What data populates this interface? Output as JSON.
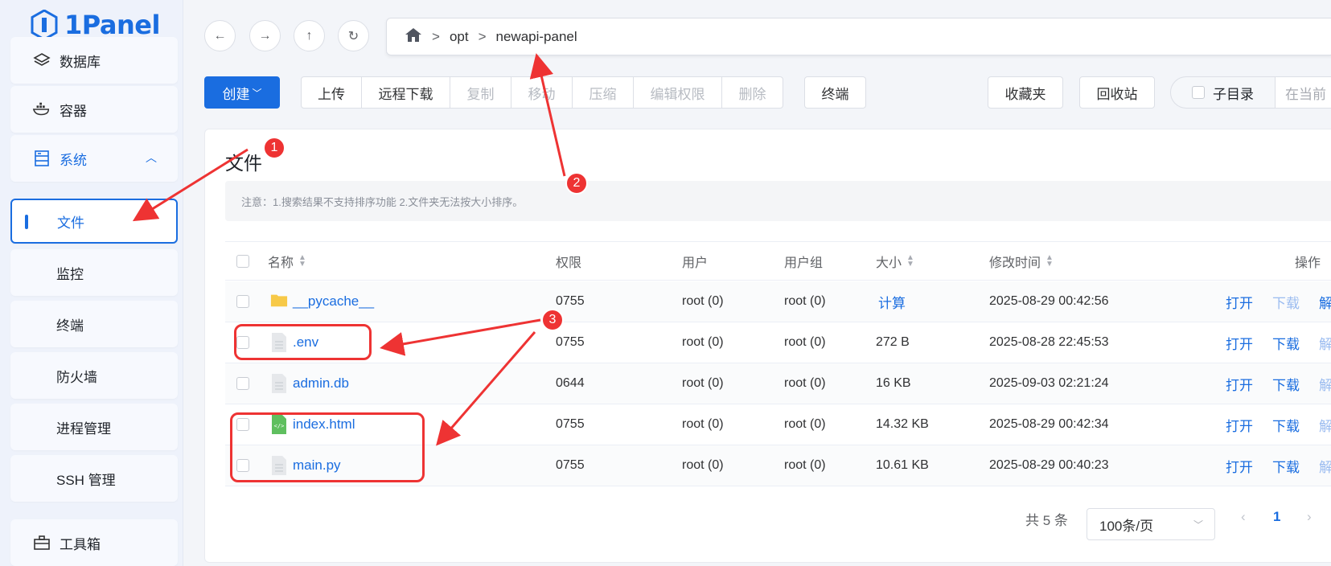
{
  "app": {
    "name": "1Panel"
  },
  "sidebar": {
    "items": [
      {
        "label": "数据库",
        "icon": "layers-icon"
      },
      {
        "label": "容器",
        "icon": "docker-icon"
      },
      {
        "label": "系统",
        "icon": "server-icon"
      },
      {
        "label": "文件"
      },
      {
        "label": "监控"
      },
      {
        "label": "终端"
      },
      {
        "label": "防火墙"
      },
      {
        "label": "进程管理"
      },
      {
        "label": "SSH 管理"
      },
      {
        "label": "工具箱",
        "icon": "toolbox-icon"
      }
    ]
  },
  "breadcrumb": {
    "segments": [
      "opt",
      "newapi-panel"
    ],
    "separator": ">"
  },
  "toolbar": {
    "create": "创建",
    "upload": "上传",
    "remote_download": "远程下载",
    "copy": "复制",
    "move": "移动",
    "compress": "压缩",
    "edit_permission": "编辑权限",
    "delete": "删除",
    "terminal": "终端",
    "favorites": "收藏夹",
    "recycle": "回收站",
    "subdir": "子目录",
    "search_placeholder": "在当前"
  },
  "card": {
    "title": "文件",
    "notice": "注意：1.搜索结果不支持排序功能 2.文件夹无法按大小排序。"
  },
  "table": {
    "headers": {
      "name": "名称",
      "perm": "权限",
      "user": "用户",
      "group": "用户组",
      "size": "大小",
      "mtime": "修改时间",
      "ops": "操作"
    },
    "rows": [
      {
        "name": "__pycache__",
        "type": "folder",
        "perm": "0755",
        "user": "root (0)",
        "group": "root (0)",
        "size": "计算",
        "mtime": "2025-08-29 00:42:56",
        "open": "打开",
        "download": "下载",
        "extra": "解"
      },
      {
        "name": ".env",
        "type": "file",
        "perm": "0755",
        "user": "root (0)",
        "group": "root (0)",
        "size": "272 B",
        "mtime": "2025-08-28 22:45:53",
        "open": "打开",
        "download": "下载",
        "extra": "解"
      },
      {
        "name": "admin.db",
        "type": "file",
        "perm": "0644",
        "user": "root (0)",
        "group": "root (0)",
        "size": "16 KB",
        "mtime": "2025-09-03 02:21:24",
        "open": "打开",
        "download": "下载",
        "extra": "解"
      },
      {
        "name": "index.html",
        "type": "html",
        "perm": "0755",
        "user": "root (0)",
        "group": "root (0)",
        "size": "14.32 KB",
        "mtime": "2025-08-29 00:42:34",
        "open": "打开",
        "download": "下载",
        "extra": "解"
      },
      {
        "name": "main.py",
        "type": "file",
        "perm": "0755",
        "user": "root (0)",
        "group": "root (0)",
        "size": "10.61 KB",
        "mtime": "2025-08-29 00:40:23",
        "open": "打开",
        "download": "下载",
        "extra": "解"
      }
    ]
  },
  "pagination": {
    "total": "共 5 条",
    "page_size": "100条/页",
    "current": "1"
  },
  "annotations": [
    "1",
    "2",
    "3"
  ],
  "colors": {
    "primary": "#1a6de0",
    "annotation": "#ee3333"
  }
}
